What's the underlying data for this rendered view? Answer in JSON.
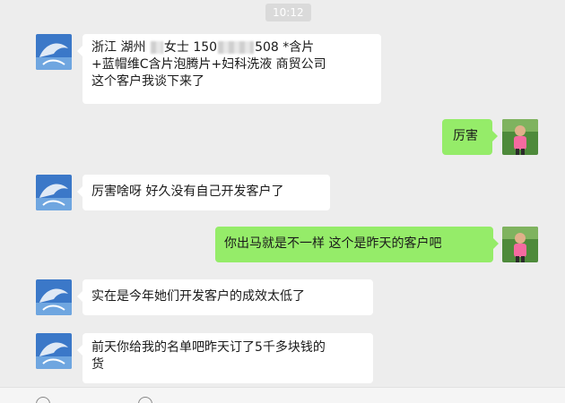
{
  "chat": {
    "timestamp": "10:12",
    "messages": [
      {
        "side": "left",
        "lines": [
          {
            "a": "浙江  湖州 ",
            "b": "女士  150",
            "c": "508  *含片"
          },
          "+蓝帽维C含片泡腾片+妇科洗液   商贸公司",
          "          这个客户我谈下来了"
        ]
      },
      {
        "side": "right",
        "text": "厉害"
      },
      {
        "side": "left",
        "text": "厉害啥呀  好久没有自己开发客户了"
      },
      {
        "side": "right",
        "text": "你出马就是不一样  这个是昨天的客户吧"
      },
      {
        "side": "left",
        "text": "实在是今年她们开发客户的成效太低了"
      },
      {
        "side": "left",
        "lines": [
          "前天你给我的名单吧昨天订了5千多块钱的",
          "货"
        ]
      }
    ]
  },
  "icons": {
    "contact_avatar": "dolphin-avatar-icon",
    "self_avatar": "person-photo-avatar-icon",
    "toolbar": [
      "emoji-icon",
      "folder-icon"
    ]
  },
  "colors": {
    "background": "#ededed",
    "left_bubble": "#ffffff",
    "right_bubble": "#95ec69",
    "timestamp_bg": "#dadada"
  }
}
